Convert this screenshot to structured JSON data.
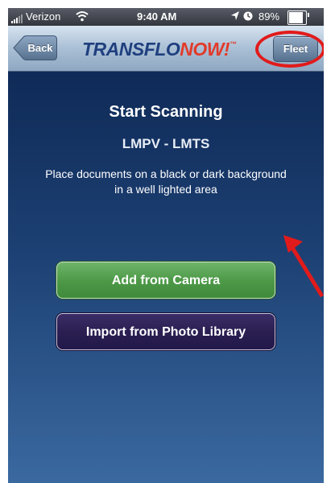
{
  "status_bar": {
    "carrier": "Verizon",
    "time": "9:40 AM",
    "battery": "89%",
    "icons": [
      "signal-icon",
      "wifi-icon",
      "location-icon",
      "lock-icon",
      "battery-icon"
    ]
  },
  "nav": {
    "back_label": "Back",
    "logo_part1": "TRANSFLO",
    "logo_part2": "NOW!",
    "logo_mark": "™",
    "fleet_label": "Fleet"
  },
  "content": {
    "title": "Start Scanning",
    "subtitle": "LMPV - LMTS",
    "instruction_line1": "Place documents on a black or dark background",
    "instruction_line2": "in a well lighted area",
    "camera_button": "Add from Camera",
    "photo_button": "Import from Photo Library"
  },
  "colors": {
    "annotation_red": "#e11b1b",
    "camera_green": "#4e9a49",
    "photo_purple": "#2b1f52",
    "background_navy": "#13305e"
  }
}
